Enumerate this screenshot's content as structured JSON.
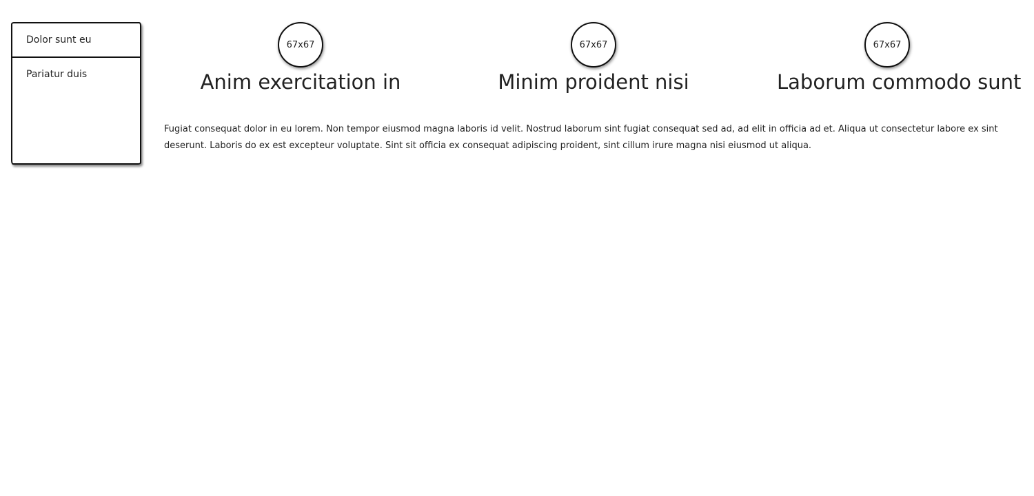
{
  "sidebar": {
    "items": [
      {
        "label": "Dolor sunt eu"
      },
      {
        "label": "Pariatur duis"
      }
    ]
  },
  "features": [
    {
      "image_label": "67x67",
      "title": "Anim exercitation in"
    },
    {
      "image_label": "67x67",
      "title": "Minim proident nisi"
    },
    {
      "image_label": "67x67",
      "title": "Laborum commodo sunt"
    }
  ],
  "body_text": "Fugiat consequat dolor in eu lorem. Non tempor eiusmod magna laboris id velit. Nostrud laborum sint fugiat consequat sed ad, ad elit in officia ad et. Aliqua ut consectetur labore ex sint deserunt. Laboris do ex est excepteur voluptate. Sint sit officia ex consequat adipiscing proident, sint cillum irure magna nisi eiusmod ut aliqua."
}
